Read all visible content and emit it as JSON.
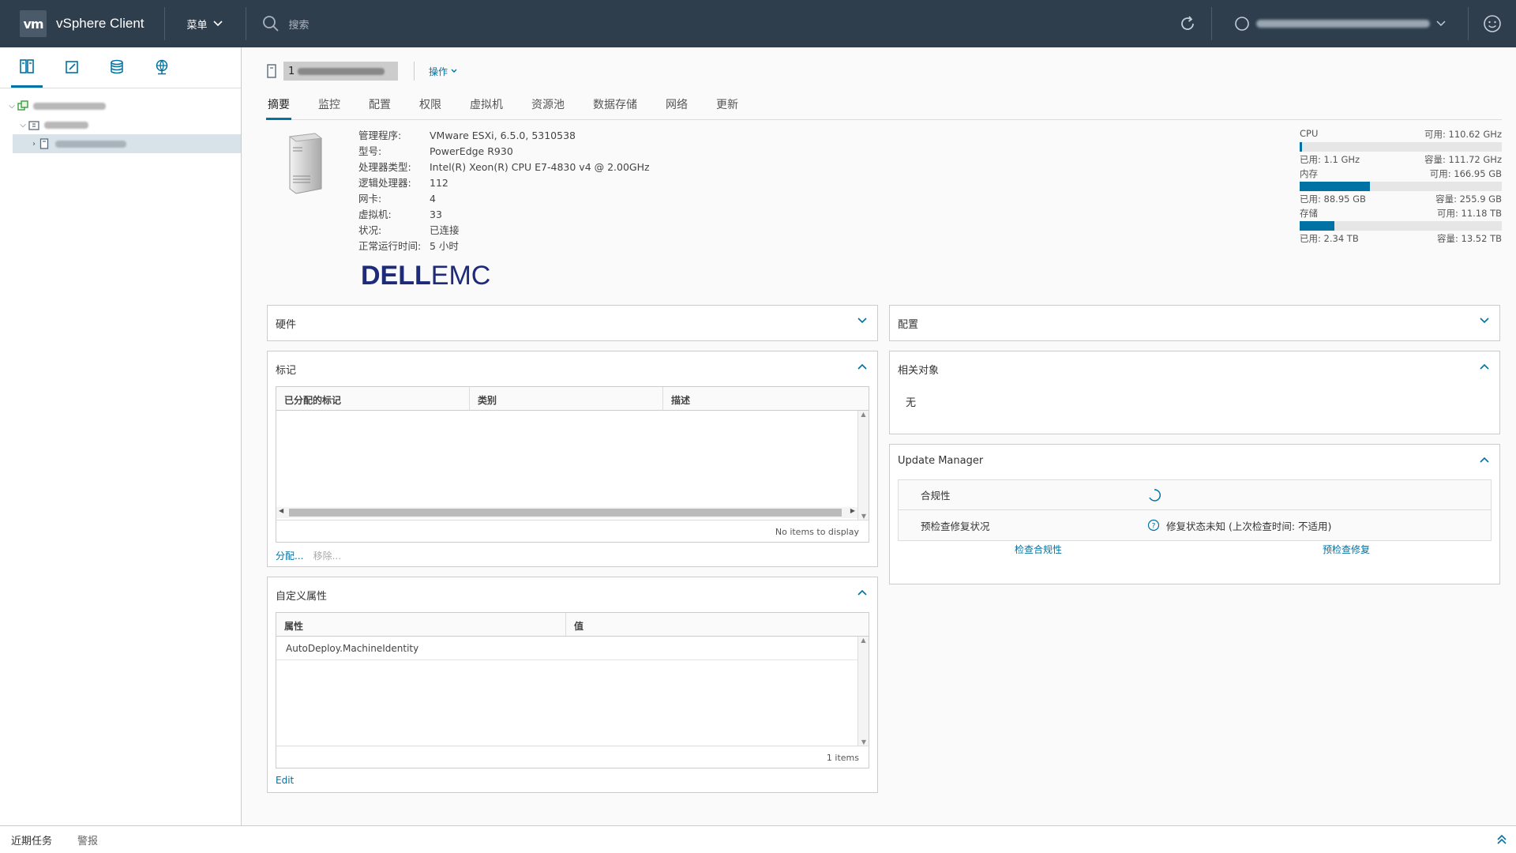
{
  "header": {
    "logo": "vm",
    "title": "vSphere Client",
    "menu_label": "菜单",
    "search_placeholder": "搜索"
  },
  "object": {
    "name_prefix": "1",
    "actions_label": "操作"
  },
  "tabs": [
    "摘要",
    "监控",
    "配置",
    "权限",
    "虚拟机",
    "资源池",
    "数据存储",
    "网络",
    "更新"
  ],
  "summary": {
    "props": [
      {
        "k": "管理程序:",
        "v": "VMware ESXi, 6.5.0, 5310538"
      },
      {
        "k": "型号:",
        "v": "PowerEdge R930"
      },
      {
        "k": "处理器类型:",
        "v": "Intel(R) Xeon(R) CPU E7-4830 v4 @ 2.00GHz"
      },
      {
        "k": "逻辑处理器:",
        "v": "112"
      },
      {
        "k": "网卡:",
        "v": "4"
      },
      {
        "k": "虚拟机:",
        "v": "33"
      },
      {
        "k": "状况:",
        "v": "已连接"
      },
      {
        "k": "正常运行时间:",
        "v": "5 小时"
      }
    ],
    "logo_dell": "DELL",
    "logo_emc": "EMC"
  },
  "resources": [
    {
      "name": "CPU",
      "free": "可用: 110.62 GHz",
      "used": "已用: 1.1 GHz",
      "capacity": "容量: 111.72 GHz",
      "fill": 0.01
    },
    {
      "name": "内存",
      "free": "可用: 166.95 GB",
      "used": "已用: 88.95 GB",
      "capacity": "容量: 255.9 GB",
      "fill": 0.348
    },
    {
      "name": "存储",
      "free": "可用: 11.18 TB",
      "used": "已用: 2.34 TB",
      "capacity": "容量: 13.52 TB",
      "fill": 0.173
    }
  ],
  "panels": {
    "hardware": "硬件",
    "config": "配置",
    "tags": {
      "title": "标记",
      "cols": [
        "已分配的标记",
        "类别",
        "描述"
      ],
      "footer": "No items to display",
      "assign": "分配...",
      "remove": "移除..."
    },
    "related": {
      "title": "相关对象",
      "value": "无"
    },
    "custom_attrs": {
      "title": "自定义属性",
      "cols": [
        "属性",
        "值"
      ],
      "rows": [
        "AutoDeploy.MachineIdentity"
      ],
      "footer": "1 items",
      "edit": "Edit"
    },
    "update_manager": {
      "title": "Update Manager",
      "compliance_label": "合规性",
      "precheck_label": "预检查修复状况",
      "precheck_value": "修复状态未知 (上次检查时间: 不适用)",
      "check_compliance": "检查合规性",
      "precheck_remediation": "预检查修复"
    }
  },
  "bottom": {
    "recent_tasks": "近期任务",
    "alarms": "警报"
  },
  "colors": {
    "header_bg": "#2e3e4d",
    "accent": "#0072a3"
  }
}
